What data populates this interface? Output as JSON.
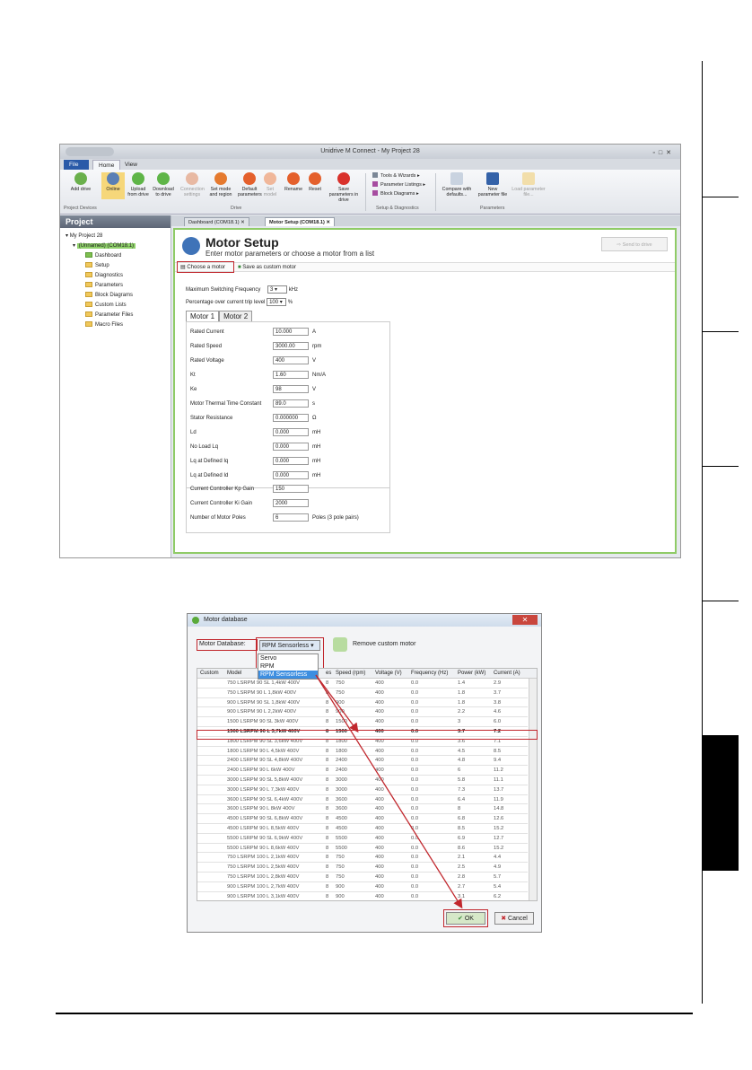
{
  "window": {
    "title": "Unidrive M Connect - My Project 28"
  },
  "menu": {
    "file": "File",
    "home": "Home",
    "view": "View"
  },
  "ribbon": {
    "buttons": [
      "Add drive",
      "Online",
      "Upload from drive",
      "Download to drive",
      "Connection settings",
      "Set mode and region",
      "Default parameters",
      "Set model",
      "Rename",
      "Reset",
      "Save parameters in drive",
      "Compare with defaults...",
      "New parameter file",
      "Load parameter file..."
    ],
    "groups": [
      "Project Devices",
      "Drive",
      "Setup & Diagnostics",
      "Parameters"
    ],
    "tools": [
      "Tools & Wizards",
      "Parameter Listings",
      "Block Diagrams"
    ]
  },
  "project": {
    "header": "Project",
    "tree": [
      "My Project 28",
      "(Unnamed) (COM18.1)",
      "Dashboard",
      "Setup",
      "Diagnostics",
      "Parameters",
      "Block Diagrams",
      "Custom Lists",
      "Parameter Files",
      "Macro Files"
    ]
  },
  "tabs": {
    "dashboard": "Dashboard (COM18.1)",
    "motor_setup": "Motor Setup (COM18.1)"
  },
  "motor_setup": {
    "title": "Motor Setup",
    "subtitle": "Enter motor parameters or choose a motor from a list",
    "send_button": "Send to drive",
    "choose_motor": "Choose a motor",
    "save_custom": "Save as custom motor",
    "max_switching_label": "Maximum Switching Frequency",
    "max_switching_value": "3",
    "max_switching_unit": "kHz",
    "pct_label": "Percentage over current trip level",
    "pct_value": "100",
    "pct_unit": "%",
    "motor_tabs": [
      "Motor 1",
      "Motor 2"
    ],
    "params": [
      {
        "label": "Rated Current",
        "value": "10.000",
        "unit": "A"
      },
      {
        "label": "Rated Speed",
        "value": "3000.00",
        "unit": "rpm"
      },
      {
        "label": "Rated Voltage",
        "value": "400",
        "unit": "V"
      },
      {
        "label": "Kt",
        "value": "1.60",
        "unit": "Nm/A"
      },
      {
        "label": "Ke",
        "value": "98",
        "unit": "V"
      },
      {
        "label": "Motor Thermal Time Constant",
        "value": "89.0",
        "unit": "s"
      },
      {
        "label": "Stator Resistance",
        "value": "0.000000",
        "unit": "Ω"
      },
      {
        "label": "Ld",
        "value": "0.000",
        "unit": "mH"
      },
      {
        "label": "No Load Lq",
        "value": "0.000",
        "unit": "mH"
      },
      {
        "label": "Lq at Defined Iq",
        "value": "0.000",
        "unit": "mH"
      },
      {
        "label": "Lq at Defined Id",
        "value": "0.000",
        "unit": "mH"
      },
      {
        "label": "Current Controller Kp Gain",
        "value": "150",
        "unit": ""
      },
      {
        "label": "Current Controller Ki Gain",
        "value": "2000",
        "unit": ""
      },
      {
        "label": "Number of Motor Poles",
        "value": "6",
        "unit": "Poles (3 pole pairs)"
      }
    ]
  },
  "motor_db": {
    "title": "Motor database",
    "db_label": "Motor Database:",
    "db_value": "RPM Sensorless",
    "options": [
      "Servo",
      "RPM",
      "RPM Sensorless"
    ],
    "remove_label": "Remove custom motor",
    "columns": [
      "Custom",
      "Model",
      "es",
      "Speed (rpm)",
      "Voltage (V)",
      "Frequency (Hz)",
      "Power (kW)",
      "Current (A)"
    ],
    "rows": [
      [
        "750 LSRPM 90 SL 1,4kW 400V",
        "8",
        "750",
        "400",
        "0.0",
        "1.4",
        "2.9"
      ],
      [
        "750 LSRPM 90 L 1,8kW 400V",
        "8",
        "750",
        "400",
        "0.0",
        "1.8",
        "3.7"
      ],
      [
        "900 LSRPM 90 SL 1,8kW 400V",
        "8",
        "900",
        "400",
        "0.0",
        "1.8",
        "3.8"
      ],
      [
        "900 LSRPM 90 L 2,2kW 400V",
        "8",
        "900",
        "400",
        "0.0",
        "2.2",
        "4.6"
      ],
      [
        "1500 LSRPM 90 SL 3kW 400V",
        "8",
        "1500",
        "400",
        "0.0",
        "3",
        "6.0"
      ],
      [
        "1500 LSRPM 90 L 3,7kW 400V",
        "8",
        "1500",
        "400",
        "0.0",
        "3.7",
        "7.2"
      ],
      [
        "1800 LSRPM 90 SL 3,6kW 400V",
        "8",
        "1800",
        "400",
        "0.0",
        "3.6",
        "7.1"
      ],
      [
        "1800 LSRPM 90 L 4,5kW 400V",
        "8",
        "1800",
        "400",
        "0.0",
        "4.5",
        "8.5"
      ],
      [
        "2400 LSRPM 90 SL 4,8kW 400V",
        "8",
        "2400",
        "400",
        "0.0",
        "4.8",
        "9.4"
      ],
      [
        "2400 LSRPM 90 L 6kW 400V",
        "8",
        "2400",
        "400",
        "0.0",
        "6",
        "11.2"
      ],
      [
        "3000 LSRPM 90 SL 5,8kW 400V",
        "8",
        "3000",
        "400",
        "0.0",
        "5.8",
        "11.1"
      ],
      [
        "3000 LSRPM 90 L 7,3kW 400V",
        "8",
        "3000",
        "400",
        "0.0",
        "7.3",
        "13.7"
      ],
      [
        "3600 LSRPM 90 SL 6,4kW 400V",
        "8",
        "3600",
        "400",
        "0.0",
        "6.4",
        "11.9"
      ],
      [
        "3600 LSRPM 90 L 8kW 400V",
        "8",
        "3600",
        "400",
        "0.0",
        "8",
        "14.8"
      ],
      [
        "4500 LSRPM 90 SL 6,8kW 400V",
        "8",
        "4500",
        "400",
        "0.0",
        "6.8",
        "12.6"
      ],
      [
        "4500 LSRPM 90 L 8,5kW 400V",
        "8",
        "4500",
        "400",
        "0.0",
        "8.5",
        "15.2"
      ],
      [
        "5500 LSRPM 90 SL 6,9kW 400V",
        "8",
        "5500",
        "400",
        "0.0",
        "6.9",
        "12.7"
      ],
      [
        "5500 LSRPM 90 L 8,6kW 400V",
        "8",
        "5500",
        "400",
        "0.0",
        "8.6",
        "15.2"
      ],
      [
        "750 LSRPM 100 L 2,1kW 400V",
        "8",
        "750",
        "400",
        "0.0",
        "2.1",
        "4.4"
      ],
      [
        "750 LSRPM 100 L 2,5kW 400V",
        "8",
        "750",
        "400",
        "0.0",
        "2.5",
        "4.9"
      ],
      [
        "750 LSRPM 100 L 2,8kW 400V",
        "8",
        "750",
        "400",
        "0.0",
        "2.8",
        "5.7"
      ],
      [
        "900 LSRPM 100 L 2,7kW 400V",
        "8",
        "900",
        "400",
        "0.0",
        "2.7",
        "5.4"
      ],
      [
        "900 LSRPM 100 L 3,1kW 400V",
        "8",
        "900",
        "400",
        "0.0",
        "3.1",
        "6.2"
      ]
    ],
    "ok": "OK",
    "cancel": "Cancel"
  }
}
